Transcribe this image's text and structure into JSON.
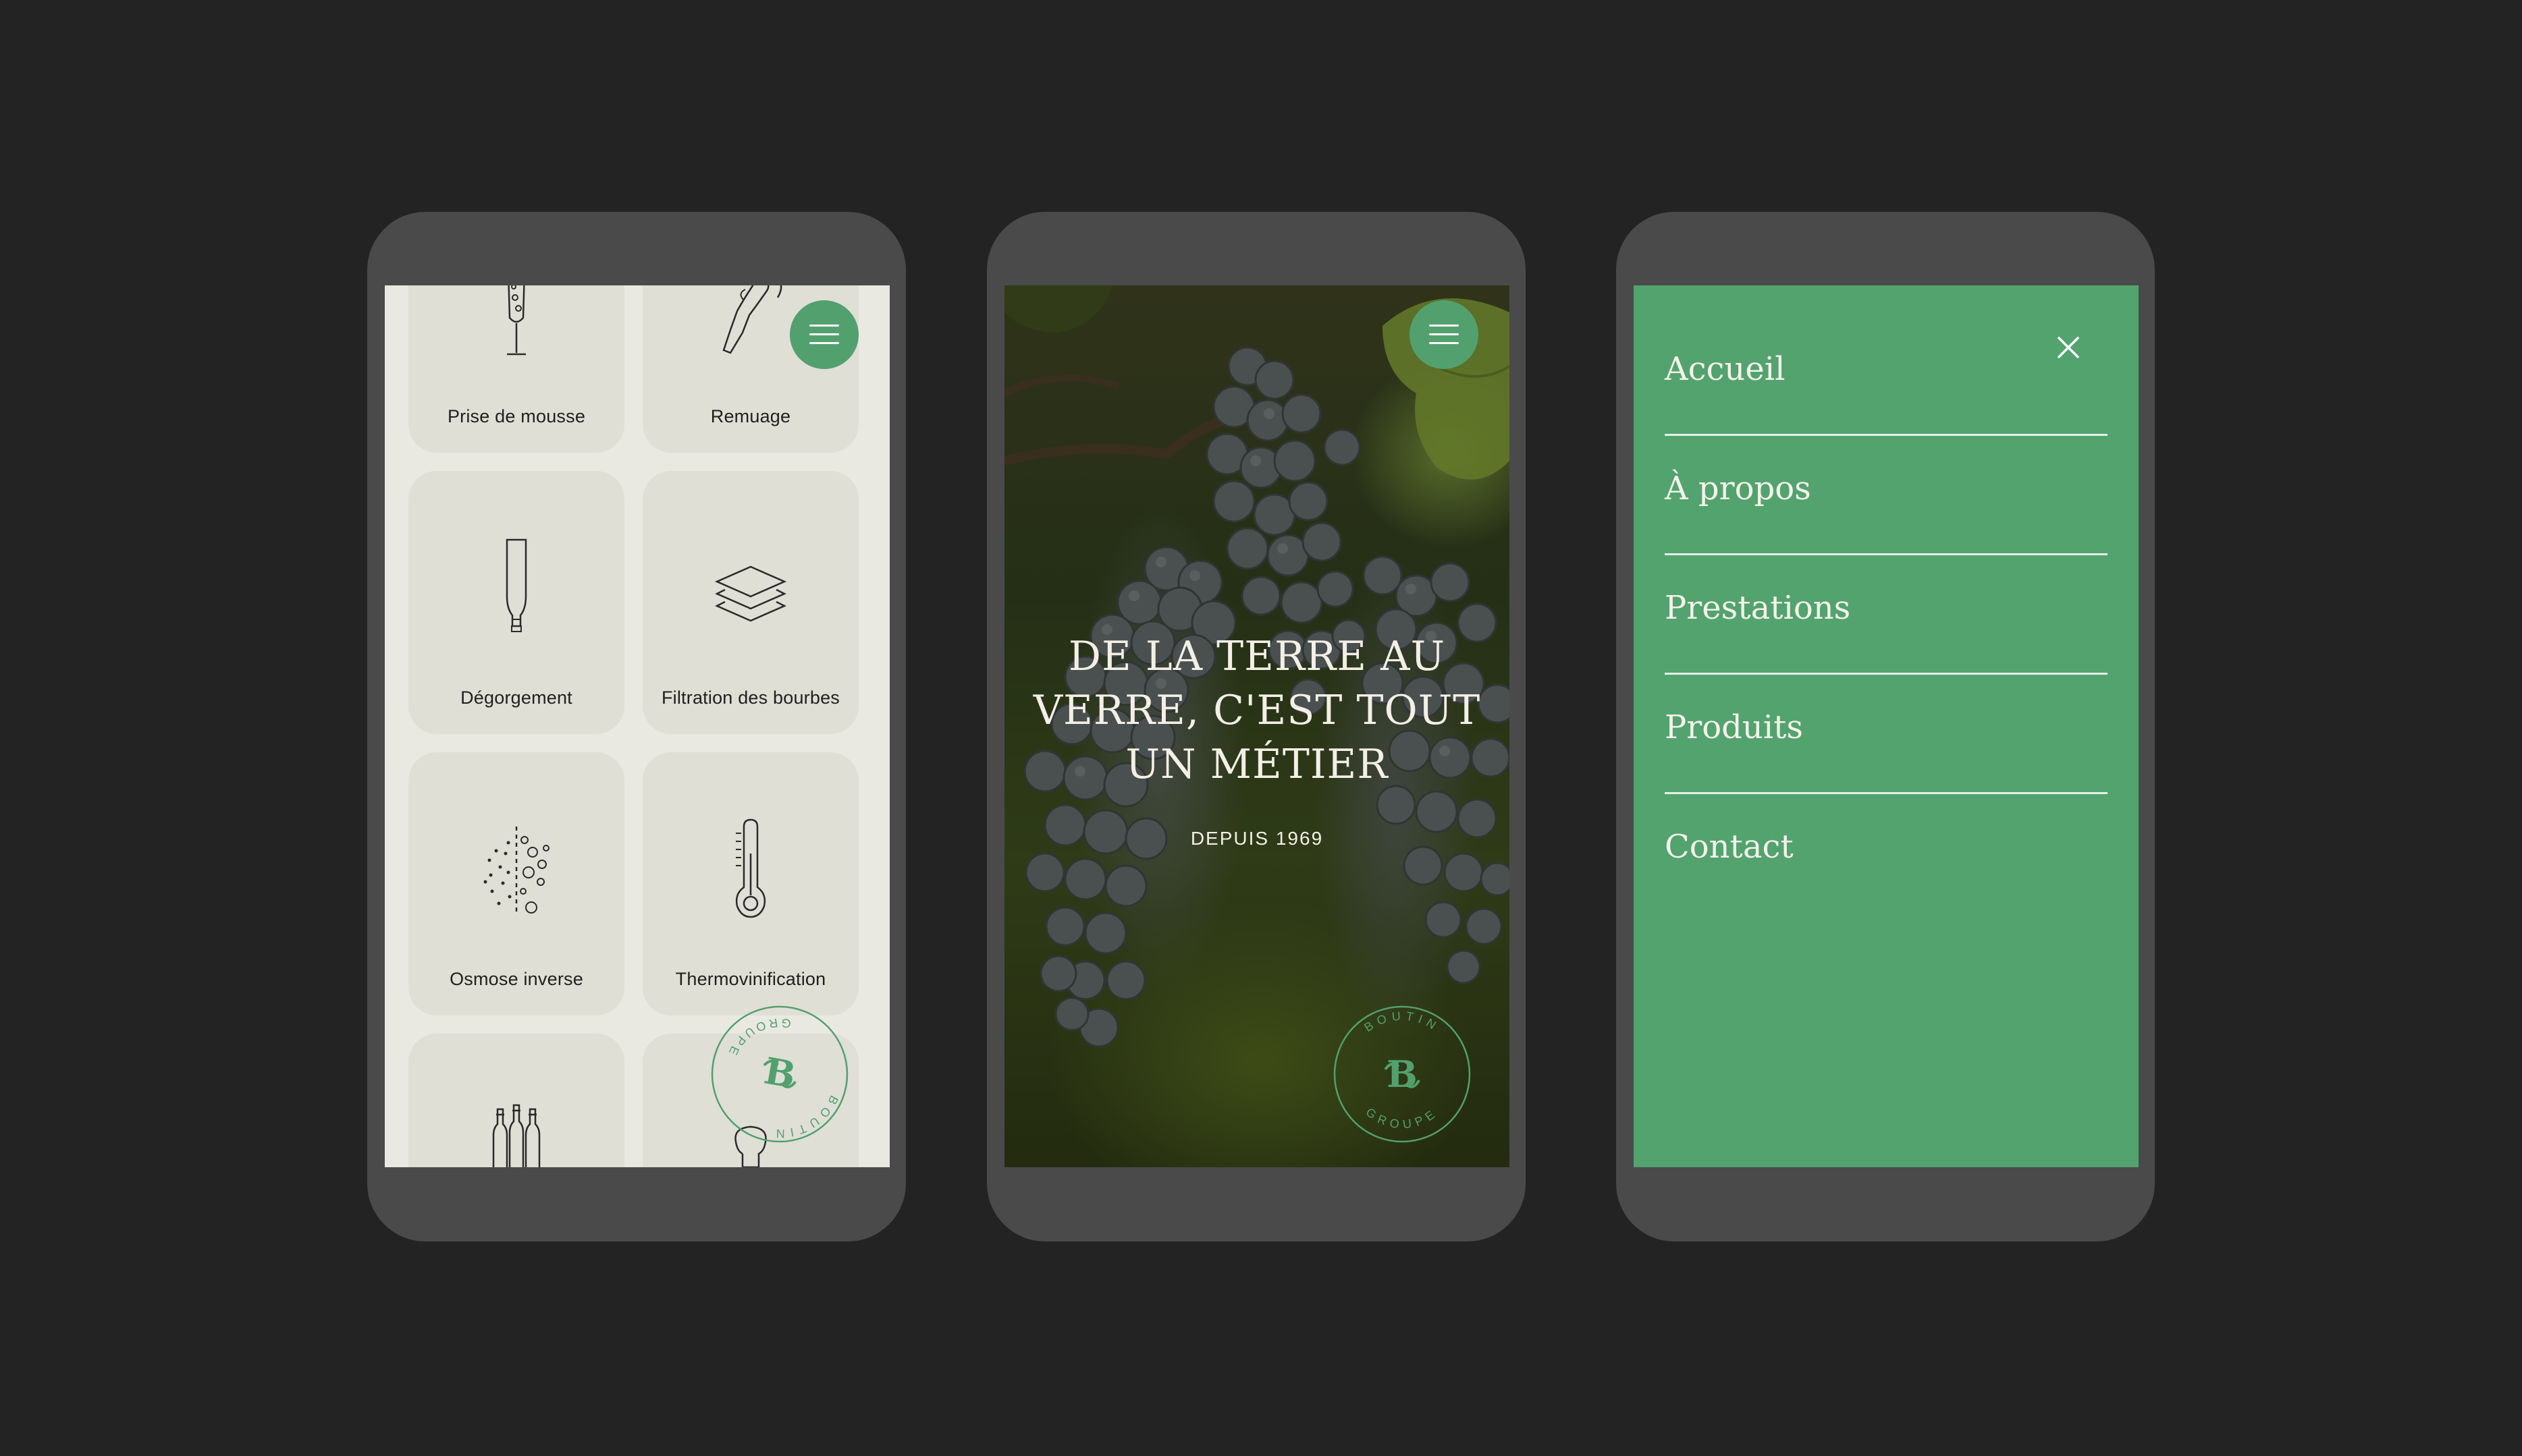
{
  "colors": {
    "background": "#232323",
    "phone_frame": "#4a4a4a",
    "accent_green": "#52a06e",
    "light_bg": "#eae9e1",
    "card_bg": "#dfdfd6"
  },
  "screen_services": {
    "menu_icon": "hamburger-icon",
    "cards": [
      {
        "label": "Prise de mousse",
        "icon": "champagne-glass-icon"
      },
      {
        "label": "Remuage",
        "icon": "tilted-bottle-icon"
      },
      {
        "label": "Dégorgement",
        "icon": "inverted-bottle-icon"
      },
      {
        "label": "Filtration des bourbes",
        "icon": "layers-icon"
      },
      {
        "label": "Osmose inverse",
        "icon": "bubbles-icon"
      },
      {
        "label": "Thermovinification",
        "icon": "thermometer-icon"
      },
      {
        "label": "",
        "icon": "bottles-icon"
      },
      {
        "label": "",
        "icon": "cork-icon"
      }
    ],
    "seal": {
      "top": "BOUTIN",
      "bottom": "GROUPE",
      "monogram": "B"
    }
  },
  "screen_hero": {
    "title": "DE LA TERRE AU VERRE, C'EST TOUT UN MÉTIER",
    "subtitle": "DEPUIS 1969",
    "menu_icon": "hamburger-icon",
    "seal": {
      "top": "BOUTIN",
      "bottom": "GROUPE",
      "monogram": "B"
    }
  },
  "screen_menu": {
    "close_icon": "close-icon",
    "items": [
      {
        "label": "Accueil"
      },
      {
        "label": "À propos"
      },
      {
        "label": "Prestations"
      },
      {
        "label": "Produits"
      },
      {
        "label": "Contact"
      }
    ]
  }
}
